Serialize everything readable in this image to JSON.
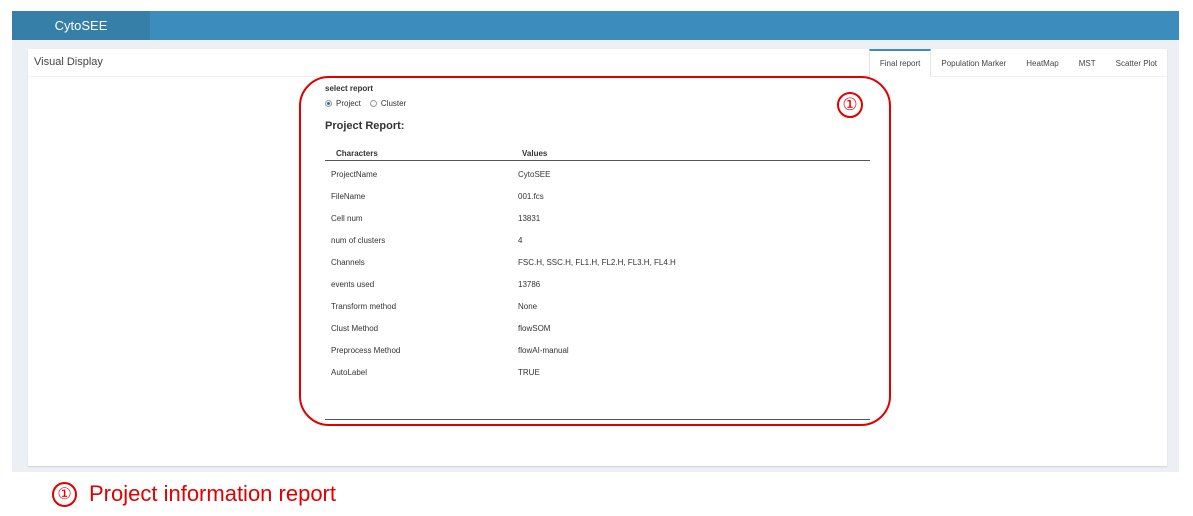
{
  "app": {
    "title": "CytoSEE"
  },
  "box": {
    "title": "Visual Display"
  },
  "tabs": [
    {
      "label": "Final report"
    },
    {
      "label": "Population Marker"
    },
    {
      "label": "HeatMap"
    },
    {
      "label": "MST"
    },
    {
      "label": "Scatter Plot"
    }
  ],
  "report": {
    "select_label": "select report",
    "options": [
      {
        "label": "Project",
        "checked": true
      },
      {
        "label": "Cluster",
        "checked": false
      }
    ],
    "heading": "Project Report:",
    "columns": [
      "Characters",
      "Values"
    ],
    "rows": [
      {
        "key": "ProjectName",
        "value": "CytoSEE"
      },
      {
        "key": "FileName",
        "value": "001.fcs"
      },
      {
        "key": "Cell num",
        "value": "13831"
      },
      {
        "key": "num of clusters",
        "value": "4"
      },
      {
        "key": "Channels",
        "value": "FSC.H, SSC.H, FL1.H, FL2.H, FL3.H, FL4.H"
      },
      {
        "key": "events used",
        "value": "13786"
      },
      {
        "key": "Transform method",
        "value": "None"
      },
      {
        "key": "Clust Method",
        "value": "flowSOM"
      },
      {
        "key": "Preprocess Method",
        "value": "flowAI-manual"
      },
      {
        "key": "AutoLabel",
        "value": "TRUE"
      }
    ]
  },
  "annotation": {
    "marker": "①",
    "caption_marker": "①",
    "caption": "Project information report",
    "color": "#e00000"
  },
  "colors": {
    "accent": "#3c8dbc",
    "brand_bg": "#367fa9"
  }
}
